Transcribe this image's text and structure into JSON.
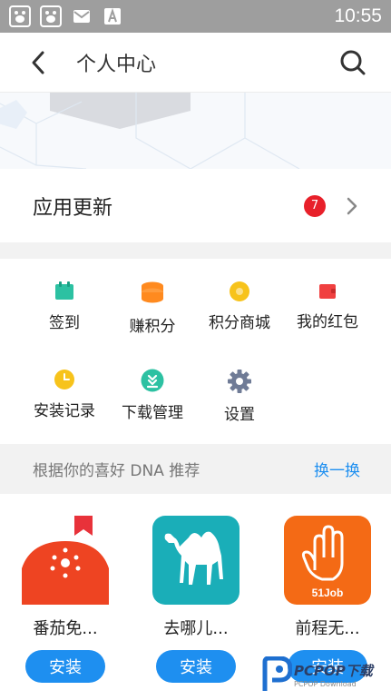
{
  "status_bar": {
    "time": "10:55",
    "icons": [
      "baidu-app-icon",
      "baidu-app-icon",
      "mail-icon",
      "font-app-icon"
    ],
    "background": "#9e9e9e"
  },
  "header": {
    "title": "个人中心",
    "back_icon": "chevron-left-icon",
    "search_icon": "search-icon"
  },
  "update": {
    "label": "应用更新",
    "badge_count": "7",
    "badge_color": "#e8202a"
  },
  "grid": {
    "items": [
      {
        "label": "签到",
        "icon": "calendar-icon",
        "color": "#2cc1a2"
      },
      {
        "label": "赚积分",
        "icon": "coin-stack-icon",
        "color": "#ff8a1f"
      },
      {
        "label": "积分商城",
        "icon": "gold-coin-icon",
        "color": "#f7c31b"
      },
      {
        "label": "我的红包",
        "icon": "red-envelope-icon",
        "color": "#f04040"
      },
      {
        "label": "安装记录",
        "icon": "clock-icon",
        "color": "#f7c31b"
      },
      {
        "label": "下载管理",
        "icon": "download-icon",
        "color": "#2cc1a2"
      },
      {
        "label": "设置",
        "icon": "gear-icon",
        "color": "#6f7b96"
      }
    ]
  },
  "recommend": {
    "title": "根据你的喜好 DNA 推荐",
    "refresh_label": "换一换",
    "accent": "#1e8ff0",
    "apps": [
      {
        "name": "番茄免...",
        "install_label": "安装",
        "icon": "tomato-novel-icon"
      },
      {
        "name": "去哪儿...",
        "install_label": "安装",
        "icon": "camel-icon"
      },
      {
        "name": "前程无...",
        "install_label": "安装",
        "icon": "hand-51job-icon",
        "icon_text": "51Job"
      }
    ]
  },
  "watermark": {
    "brand": "PCPOP下载",
    "sub": "PCPOP Download"
  }
}
